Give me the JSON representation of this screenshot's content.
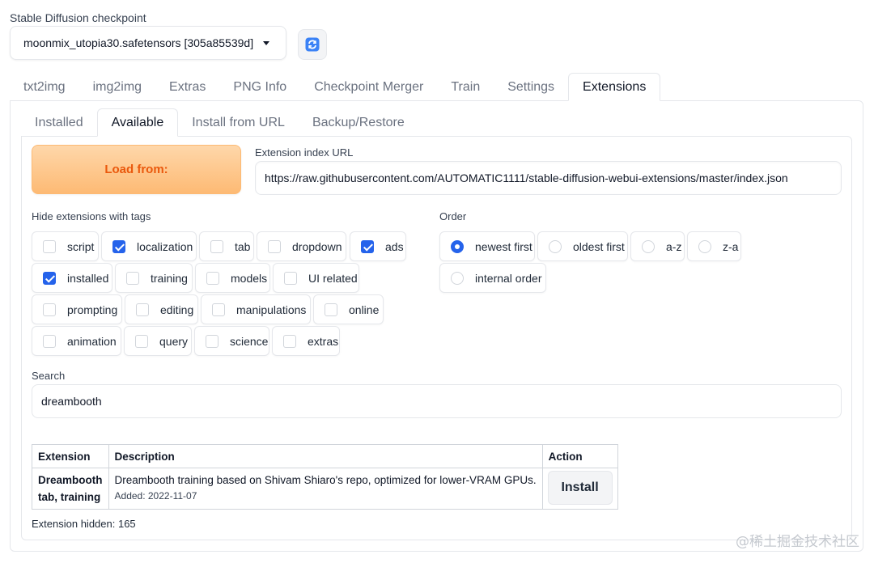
{
  "checkpoint": {
    "label": "Stable Diffusion checkpoint",
    "selected": "moonmix_utopia30.safetensors [305a85539d]",
    "refresh_icon": "refresh-icon"
  },
  "main_tabs": [
    "txt2img",
    "img2img",
    "Extras",
    "PNG Info",
    "Checkpoint Merger",
    "Train",
    "Settings",
    "Extensions"
  ],
  "main_tab_active": "Extensions",
  "sub_tabs": [
    "Installed",
    "Available",
    "Install from URL",
    "Backup/Restore"
  ],
  "sub_tab_active": "Available",
  "load_button": "Load from:",
  "index_url": {
    "label": "Extension index URL",
    "value": "https://raw.githubusercontent.com/AUTOMATIC1111/stable-diffusion-webui-extensions/master/index.json"
  },
  "hide_tags": {
    "label": "Hide extensions with tags",
    "items": [
      {
        "label": "script",
        "checked": false
      },
      {
        "label": "localization",
        "checked": true
      },
      {
        "label": "tab",
        "checked": false
      },
      {
        "label": "dropdown",
        "checked": false
      },
      {
        "label": "ads",
        "checked": true
      },
      {
        "label": "installed",
        "checked": true
      },
      {
        "label": "training",
        "checked": false
      },
      {
        "label": "models",
        "checked": false
      },
      {
        "label": "UI related",
        "checked": false
      },
      {
        "label": "prompting",
        "checked": false
      },
      {
        "label": "editing",
        "checked": false
      },
      {
        "label": "manipulations",
        "checked": false
      },
      {
        "label": "online",
        "checked": false
      },
      {
        "label": "animation",
        "checked": false
      },
      {
        "label": "query",
        "checked": false
      },
      {
        "label": "science",
        "checked": false
      },
      {
        "label": "extras",
        "checked": false
      }
    ]
  },
  "order": {
    "label": "Order",
    "options": [
      {
        "label": "newest first",
        "selected": true
      },
      {
        "label": "oldest first",
        "selected": false
      },
      {
        "label": "a-z",
        "selected": false
      },
      {
        "label": "z-a",
        "selected": false
      },
      {
        "label": "internal order",
        "selected": false
      }
    ]
  },
  "search": {
    "label": "Search",
    "value": "dreambooth"
  },
  "table": {
    "headers": [
      "Extension",
      "Description",
      "Action"
    ],
    "rows": [
      {
        "name_line1": "Dreambooth",
        "name_line2": "tab, training",
        "description": "Dreambooth training based on Shivam Shiaro's repo, optimized for lower-VRAM GPUs.",
        "added": "Added: 2022-11-07",
        "action": "Install"
      }
    ]
  },
  "hidden_count": "Extension hidden: 165",
  "watermark": "@稀土掘金技术社区",
  "colors": {
    "accent": "#2563eb",
    "load_button_text": "#ea580c",
    "load_button_bg": "#fdba74"
  }
}
